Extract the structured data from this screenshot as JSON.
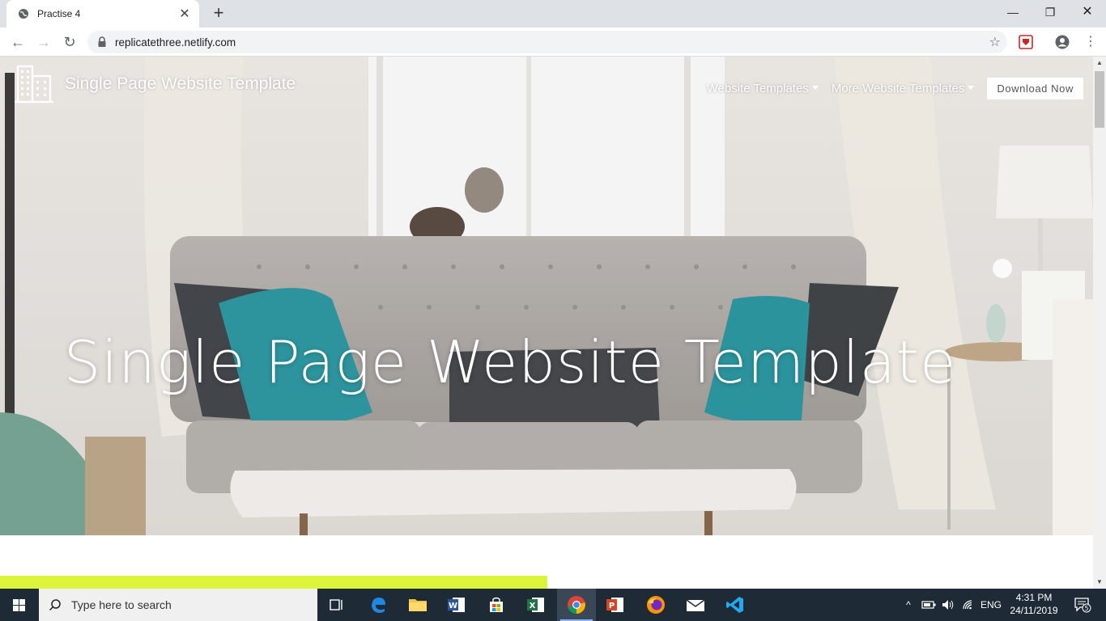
{
  "browser": {
    "tab_title": "Practise 4",
    "url": "replicatethree.netlify.com",
    "window_controls": [
      "minimize-icon",
      "restore-icon",
      "close-icon"
    ]
  },
  "site": {
    "brand_name": "Single Page Website Template",
    "nav": {
      "item1": "Website Templates",
      "item2": "More Website Templates",
      "cta": "Download Now"
    },
    "hero_heading": "Single Page Website Template"
  },
  "taskbar": {
    "search_placeholder": "Type here to search",
    "apps": [
      "task-view-icon",
      "edge-icon",
      "file-explorer-icon",
      "word-icon",
      "store-icon",
      "excel-icon",
      "chrome-icon",
      "powerpoint-icon",
      "firefox-icon",
      "mail-icon",
      "vscode-icon"
    ],
    "language": "ENG",
    "time": "4:31 PM",
    "date": "24/11/2019",
    "notifications": "5"
  },
  "colors": {
    "accent_bar": "#dcf53c",
    "taskbar": "#1f2a37",
    "tabbar": "#dee1e6"
  }
}
